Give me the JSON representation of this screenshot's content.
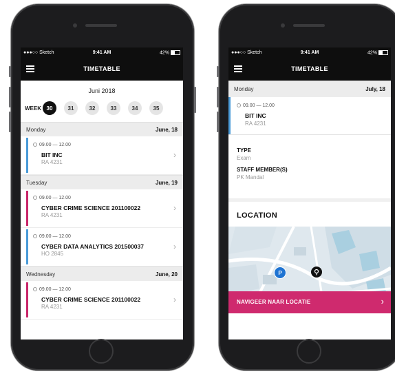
{
  "status": {
    "carrier": "●●●○○ Sketch",
    "time": "9:41 AM",
    "battery": "42%"
  },
  "header": {
    "title": "TIMETABLE"
  },
  "calendar": {
    "month": "Juni 2018",
    "week_label": "WEEK",
    "weeks": [
      "30",
      "31",
      "32",
      "33",
      "34",
      "35"
    ],
    "active_week": "30"
  },
  "days": [
    {
      "name": "Monday",
      "date": "June, 18",
      "events": [
        {
          "time": "09.00 — 12.00",
          "name": "BIT INC",
          "room": "RA 4231",
          "color": "#4a9bd8"
        }
      ]
    },
    {
      "name": "Tuesday",
      "date": "June, 19",
      "events": [
        {
          "time": "09.00 — 12.00",
          "name": "CYBER CRIME SCIENCE 201100022",
          "room": "RA 4231",
          "color": "#c9266a"
        },
        {
          "time": "09.00 — 12.00",
          "name": "CYBER DATA ANALYTICS 201500037",
          "room": "HO 2845",
          "color": "#4a9bd8"
        }
      ]
    },
    {
      "name": "Wednesday",
      "date": "June, 20",
      "events": [
        {
          "time": "09.00 — 12.00",
          "name": "CYBER CRIME SCIENCE 201100022",
          "room": "RA 4231",
          "color": "#c9266a"
        }
      ]
    }
  ],
  "detail": {
    "day": "Monday",
    "date": "July, 18",
    "event": {
      "time": "09.00 — 12.00",
      "name": "BIT INC",
      "room": "RA 4231",
      "color": "#4a9bd8"
    },
    "type_label": "TYPE",
    "type_value": "Exam",
    "staff_label": "STAFF MEMBER(S)",
    "staff_value": "PK Mandal",
    "location_title": "LOCATION",
    "map_pin": "P",
    "navigate_label": "NAVIGEER NAAR LOCATIE"
  }
}
